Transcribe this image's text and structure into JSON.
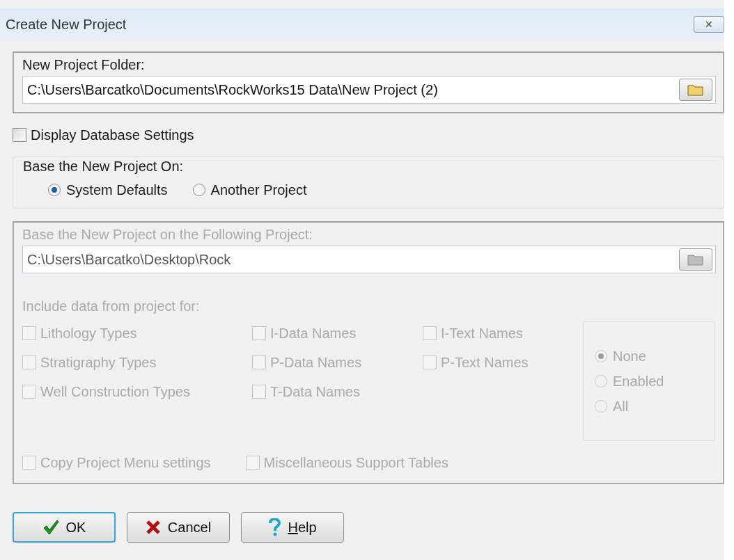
{
  "window": {
    "title": "Create New Project",
    "close": "✕"
  },
  "folder": {
    "label": "New Project Folder:",
    "value": "C:\\Users\\Barcatko\\Documents\\RockWorks15 Data\\New Project (2)"
  },
  "display_settings": {
    "label": "Display Database Settings",
    "checked": false
  },
  "base_on": {
    "label": "Base the New Project On:",
    "options": [
      {
        "label": "System Defaults",
        "selected": true
      },
      {
        "label": "Another Project",
        "selected": false
      }
    ]
  },
  "source": {
    "disabled": true,
    "label": "Base the New Project on the Following Project:",
    "value": "C:\\Users\\Barcatko\\Desktop\\Rock",
    "include_label": "Include data from project for:",
    "columns": [
      [
        {
          "label": "Lithology Types",
          "checked": false
        },
        {
          "label": "Stratigraphy Types",
          "checked": false
        },
        {
          "label": "Well Construction Types",
          "checked": false
        }
      ],
      [
        {
          "label": "I-Data Names",
          "checked": false
        },
        {
          "label": "P-Data Names",
          "checked": false
        },
        {
          "label": "T-Data Names",
          "checked": false
        }
      ],
      [
        {
          "label": "I-Text Names",
          "checked": false
        },
        {
          "label": "P-Text Names",
          "checked": false
        }
      ]
    ],
    "modes": [
      {
        "label": "None",
        "selected": true
      },
      {
        "label": "Enabled",
        "selected": false
      },
      {
        "label": "All",
        "selected": false
      }
    ],
    "extras": [
      {
        "label": "Copy Project Menu settings",
        "checked": false
      },
      {
        "label": "Miscellaneous Support Tables",
        "checked": false
      }
    ]
  },
  "buttons": [
    {
      "kind": "ok",
      "label": "OK",
      "default": true
    },
    {
      "kind": "cancel",
      "label": "Cancel",
      "default": false
    },
    {
      "kind": "help",
      "label": "Help",
      "default": false
    }
  ]
}
